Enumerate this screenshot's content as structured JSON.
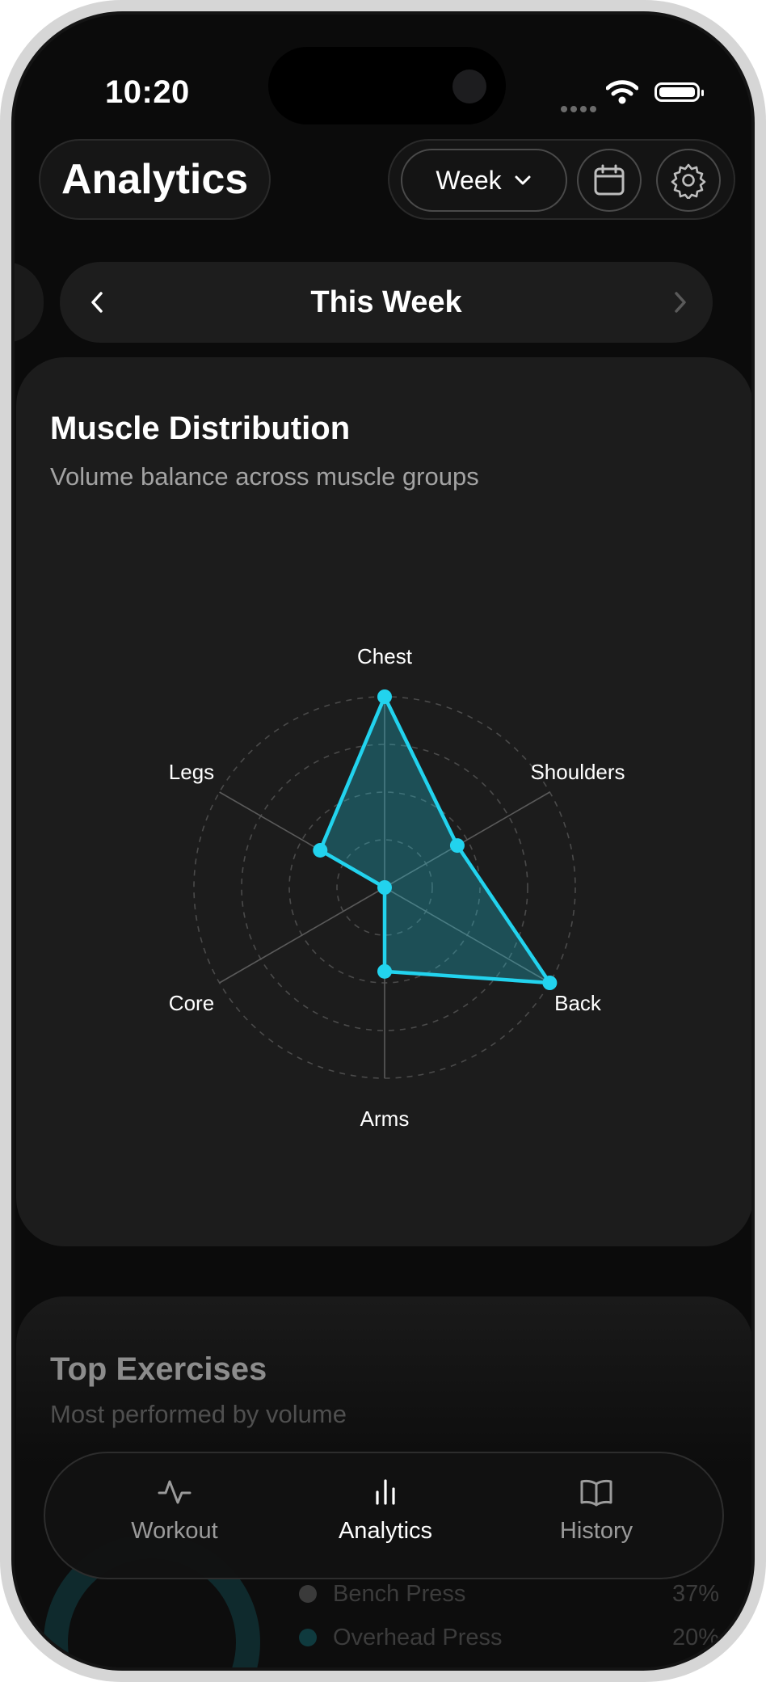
{
  "status_bar": {
    "time": "10:20"
  },
  "header": {
    "title": "Analytics",
    "period_select": "Week"
  },
  "period_nav": {
    "label": "This Week"
  },
  "muscle_card": {
    "title": "Muscle Distribution",
    "subtitle": "Volume balance across muscle groups"
  },
  "chart_data": {
    "type": "radar",
    "axes": [
      "Chest",
      "Shoulders",
      "Back",
      "Arms",
      "Core",
      "Legs"
    ],
    "values": [
      1.0,
      0.44,
      1.0,
      0.44,
      0.0,
      0.39
    ],
    "rings": 4,
    "color": "#22d3ee"
  },
  "top_exercises_card": {
    "title": "Top Exercises",
    "subtitle": "Most performed by volume",
    "items": [
      {
        "name": "Bench Press",
        "percent": "37%",
        "color": "#3a3a3a"
      },
      {
        "name": "Overhead Press",
        "percent": "20%",
        "color": "#0f3a3e"
      }
    ]
  },
  "tabbar": {
    "tabs": [
      {
        "label": "Workout",
        "icon": "activity-icon",
        "active": false
      },
      {
        "label": "Analytics",
        "icon": "bar-chart-icon",
        "active": true
      },
      {
        "label": "History",
        "icon": "book-icon",
        "active": false
      }
    ]
  },
  "colors": {
    "accent": "#22d3ee",
    "background": "#0b0b0b",
    "card": "#1c1c1c"
  }
}
